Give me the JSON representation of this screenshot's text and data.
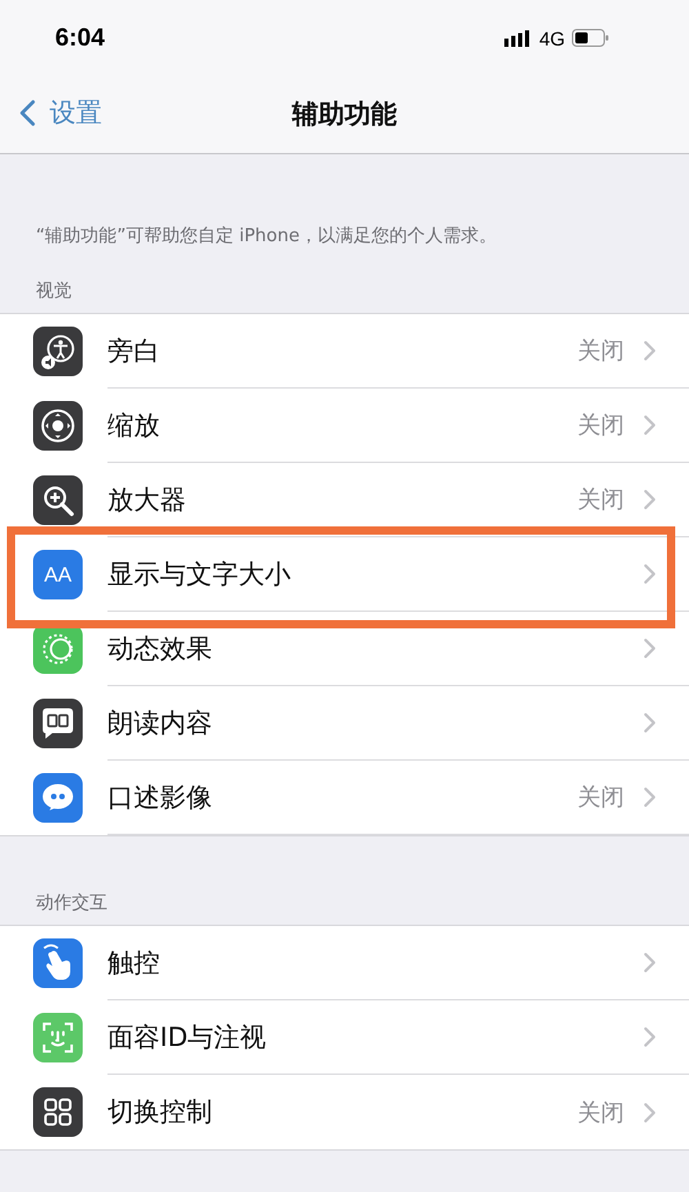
{
  "status_bar": {
    "time": "6:04",
    "network": "4G"
  },
  "nav": {
    "back": "设置",
    "title": "辅助功能"
  },
  "description": "“辅助功能”可帮助您自定 iPhone，以满足您的个人需求。",
  "sections": [
    {
      "header": "视觉",
      "rows": [
        {
          "kind": "accessibility",
          "color": "#3a3a3c",
          "label": "旁白",
          "value": "关闭",
          "highlighted": false
        },
        {
          "kind": "zoom",
          "color": "#3a3a3c",
          "label": "缩放",
          "value": "关闭",
          "highlighted": false
        },
        {
          "kind": "magnifier",
          "color": "#3a3a3c",
          "label": "放大器",
          "value": "关闭",
          "highlighted": false
        },
        {
          "kind": "textsize",
          "icon_text": "AA",
          "color": "#2a7be4",
          "label": "显示与文字大小",
          "highlighted": true
        },
        {
          "kind": "motion",
          "color": "#4cc45c",
          "label": "动态效果",
          "highlighted": false
        },
        {
          "kind": "speech",
          "color": "#3a3a3c",
          "label": "朗读内容",
          "highlighted": false
        },
        {
          "kind": "quote",
          "color": "#2a7be4",
          "label": "口述影像",
          "value": "关闭",
          "highlighted": false
        }
      ]
    },
    {
      "header": "动作交互",
      "rows": [
        {
          "kind": "hand",
          "color": "#2a7be4",
          "label": "触控",
          "highlighted": false
        },
        {
          "kind": "face",
          "color": "#5cc868",
          "label": "面容ID与注视",
          "highlighted": false
        },
        {
          "kind": "grid",
          "color": "#3a3a3c",
          "label": "切换控制",
          "value": "关闭",
          "highlighted": false
        }
      ]
    }
  ]
}
